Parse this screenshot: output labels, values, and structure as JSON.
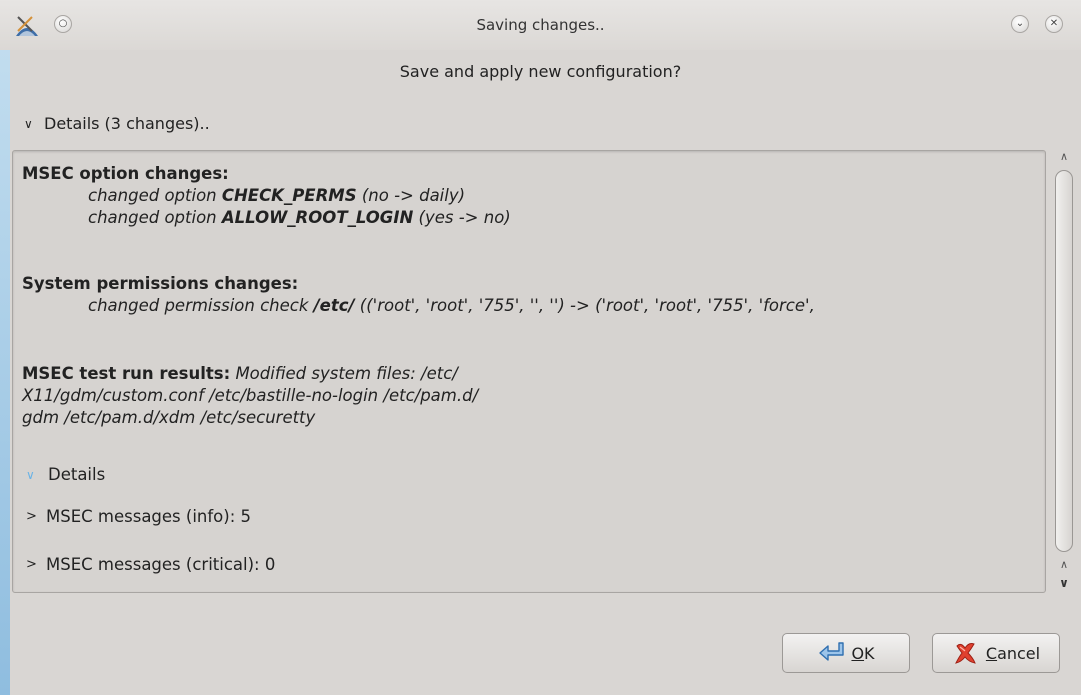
{
  "window": {
    "title": "Saving changes..",
    "shade_glyph": "○",
    "minimize_glyph": "⌄",
    "close_glyph": "✕"
  },
  "dialog": {
    "question": "Save and apply new configuration?",
    "details_toggle": {
      "chevron": "∨",
      "label": "Details (3 changes).."
    }
  },
  "details_text": {
    "msec_heading": "MSEC option changes:",
    "msec_changes": [
      {
        "prefix": "changed option ",
        "option": "CHECK_PERMS",
        "suffix": " (no -> daily)"
      },
      {
        "prefix": "changed option ",
        "option": "ALLOW_ROOT_LOGIN",
        "suffix": " (yes -> no)"
      }
    ],
    "perm_heading": "System permissions changes:",
    "perm_change": {
      "prefix": "changed permission check ",
      "path": "/etc/",
      "suffix": " (('root', 'root', '755', '', '') -> ('root', 'root', '755', 'force',"
    },
    "results_heading": "MSEC test run results:",
    "results_line1": " Modified system files: /etc/",
    "results_line2": "X11/gdm/custom.conf /etc/bastille-no-login /etc/pam.d/",
    "results_line3": "gdm /etc/pam.d/xdm /etc/securetty",
    "sub_details": {
      "chevron": "∨",
      "label": "Details"
    },
    "messages": [
      {
        "chevron": ">",
        "label": "MSEC messages (info): 5"
      },
      {
        "chevron": ">",
        "label": "MSEC messages (critical): 0"
      }
    ]
  },
  "scrollbar": {
    "up_glyph": "∧",
    "down_up_glyph": "∧",
    "down_glyph": "∨"
  },
  "buttons": {
    "ok": {
      "mnemonic": "O",
      "rest": "K"
    },
    "cancel": {
      "mnemonic": "C",
      "rest": "ancel"
    }
  },
  "colors": {
    "window_bg": "#d9d6d3",
    "frame_accent": "#8fbddf",
    "link_chevron": "#6ab3e6",
    "cancel_icon": "#e0412f",
    "ok_icon": "#4a8fd0"
  }
}
